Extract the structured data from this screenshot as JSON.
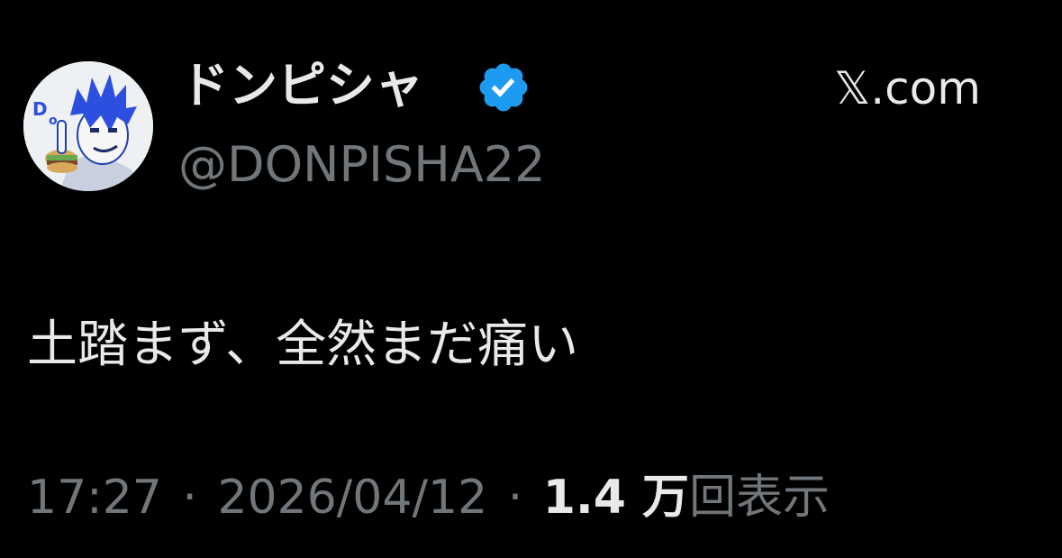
{
  "tweet": {
    "author": {
      "display_name": "ドンピシャ",
      "handle": "@DONPISHA22",
      "verified": true,
      "avatar_icon": "user-avatar-illustration"
    },
    "brand": "𝕏.com",
    "text": "土踏まず、全然まだ痛い",
    "meta": {
      "time": "17:27",
      "separator": "·",
      "date": "2026/04/12",
      "views_count": "1.4 万",
      "views_label": "回表示"
    }
  },
  "colors": {
    "background": "#000000",
    "primary_text": "#e7e9ea",
    "secondary_text": "#71767b",
    "verified_badge": "#1d9bf0"
  }
}
